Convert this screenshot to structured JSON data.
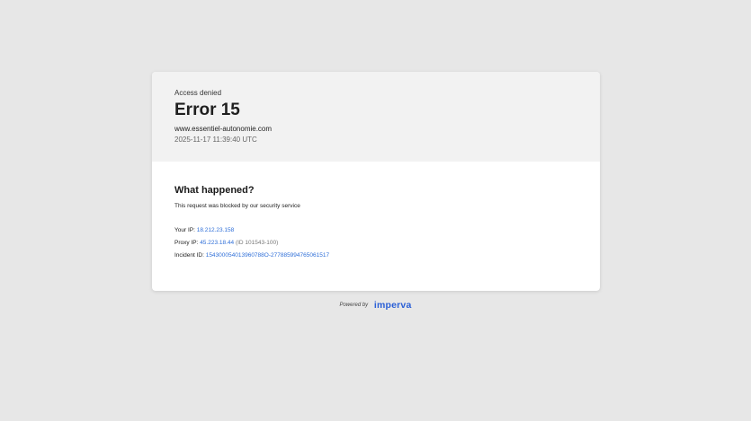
{
  "header": {
    "status": "Access denied",
    "error_title": "Error 15",
    "site": "www.essentiel-autonomie.com",
    "timestamp": "2025-11-17 11:39:40 UTC"
  },
  "body": {
    "heading": "What happened?",
    "explanation": "This request was blocked by our security service",
    "details": {
      "your_ip_label": "Your IP:",
      "your_ip_value": "18.212.23.158",
      "proxy_ip_label": "Proxy IP:",
      "proxy_ip_value": "45.223.18.44",
      "proxy_ip_note": "(ID 101543-100)",
      "incident_label": "Incident ID:",
      "incident_value": "154300054013960788O-277885994765061517"
    }
  },
  "footer": {
    "powered_by": "Powered by",
    "brand": "imperva"
  },
  "colors": {
    "background": "#e7e7e7",
    "header_background": "#f2f2f2",
    "link": "#2f6fd8",
    "brand": "#2a5fd6"
  }
}
